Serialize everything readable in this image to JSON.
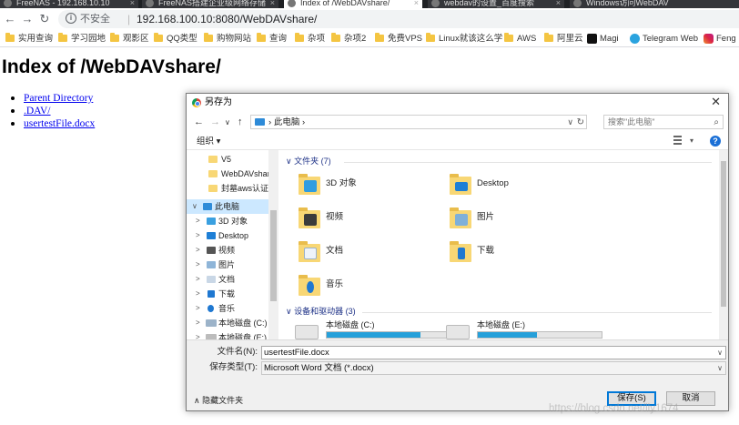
{
  "browser": {
    "tabs": [
      {
        "label": "FreeNAS - 192.168.10.10",
        "active": false
      },
      {
        "label": "FreeNAS搭建企业级网络存储",
        "active": false
      },
      {
        "label": "Index of /WebDAVshare/",
        "active": true
      },
      {
        "label": "webdav的设置_百度搜索",
        "active": false
      },
      {
        "label": "Windows访问WebDAV",
        "active": false
      }
    ],
    "insecure_label": "不安全",
    "url": "192.168.100.10:8080/WebDAVshare/",
    "bookmarks": [
      {
        "label": "实用查询",
        "icon": "folder-icon"
      },
      {
        "label": "学习园地",
        "icon": "folder-icon"
      },
      {
        "label": "观影区",
        "icon": "folder-icon"
      },
      {
        "label": "QQ类型",
        "icon": "folder-icon"
      },
      {
        "label": "购物网站",
        "icon": "folder-icon"
      },
      {
        "label": "查询",
        "icon": "folder-icon"
      },
      {
        "label": "杂项",
        "icon": "folder-icon"
      },
      {
        "label": "杂项2",
        "icon": "folder-icon"
      },
      {
        "label": "免费VPS",
        "icon": "folder-icon"
      },
      {
        "label": "Linux就该这么学",
        "icon": "folder-icon"
      },
      {
        "label": "AWS",
        "icon": "folder-icon"
      },
      {
        "label": "阿里云",
        "icon": "folder-icon"
      },
      {
        "label": "Magi",
        "icon": "magi-icon"
      },
      {
        "label": "Telegram Web",
        "icon": "telegram-icon"
      },
      {
        "label": "Feng L",
        "icon": "instagram-icon"
      }
    ]
  },
  "page": {
    "title": "Index of /WebDAVshare/",
    "links": [
      "Parent Directory",
      ".DAV/",
      "usertestFile.docx"
    ]
  },
  "dialog": {
    "title": "另存为",
    "address": "此电脑",
    "search_placeholder": "搜索\"此电脑\"",
    "organize_label": "组织 ▾",
    "nav_items": [
      {
        "label": "V5",
        "icon": "folder-icon",
        "expand": ""
      },
      {
        "label": "WebDAVshare",
        "icon": "folder-icon",
        "expand": ""
      },
      {
        "label": "封墓aws认证",
        "icon": "folder-icon",
        "expand": ""
      },
      {
        "label": "此电脑",
        "icon": "computer-icon",
        "expand": "∨",
        "selected": true
      },
      {
        "label": "3D 对象",
        "icon": "3d-objects-icon",
        "expand": ">"
      },
      {
        "label": "Desktop",
        "icon": "desktop-icon",
        "expand": ">"
      },
      {
        "label": "视频",
        "icon": "video-icon",
        "expand": ">"
      },
      {
        "label": "图片",
        "icon": "pictures-icon",
        "expand": ">"
      },
      {
        "label": "文档",
        "icon": "documents-icon",
        "expand": ">"
      },
      {
        "label": "下载",
        "icon": "download-icon",
        "expand": ">"
      },
      {
        "label": "音乐",
        "icon": "music-icon",
        "expand": ">"
      },
      {
        "label": "本地磁盘 (C:)",
        "icon": "drive-icon",
        "expand": ">"
      },
      {
        "label": "本地磁盘 (E:)",
        "icon": "drive-icon",
        "expand": ">"
      }
    ],
    "folders_header": "文件夹 (7)",
    "folders": [
      {
        "label": "3D 对象",
        "icon": "3d-objects-icon"
      },
      {
        "label": "Desktop",
        "icon": "desktop-icon"
      },
      {
        "label": "视频",
        "icon": "video-icon"
      },
      {
        "label": "图片",
        "icon": "pictures-icon"
      },
      {
        "label": "文档",
        "icon": "documents-icon"
      },
      {
        "label": "下载",
        "icon": "download-icon"
      },
      {
        "label": "音乐",
        "icon": "music-icon"
      }
    ],
    "drives_header": "设备和驱动器 (3)",
    "drives": [
      {
        "label": "本地磁盘 (C:)",
        "used_fraction": 0.76
      },
      {
        "label": "本地磁盘 (E:)",
        "used_fraction": 0.48
      }
    ],
    "filename_label": "文件名(N):",
    "filename_value": "usertestFile.docx",
    "filetype_label": "保存类型(T):",
    "filetype_value": "Microsoft Word 文档 (*.docx)",
    "hide_folders_label": "隐藏文件夹",
    "save_label": "保存(S)",
    "cancel_label": "取消",
    "colors": {
      "accent": "#0078d7",
      "selection": "#cce8ff",
      "drive_bar": "#26a0da"
    }
  },
  "watermark": "https://blog.csdn.net/lly1674"
}
